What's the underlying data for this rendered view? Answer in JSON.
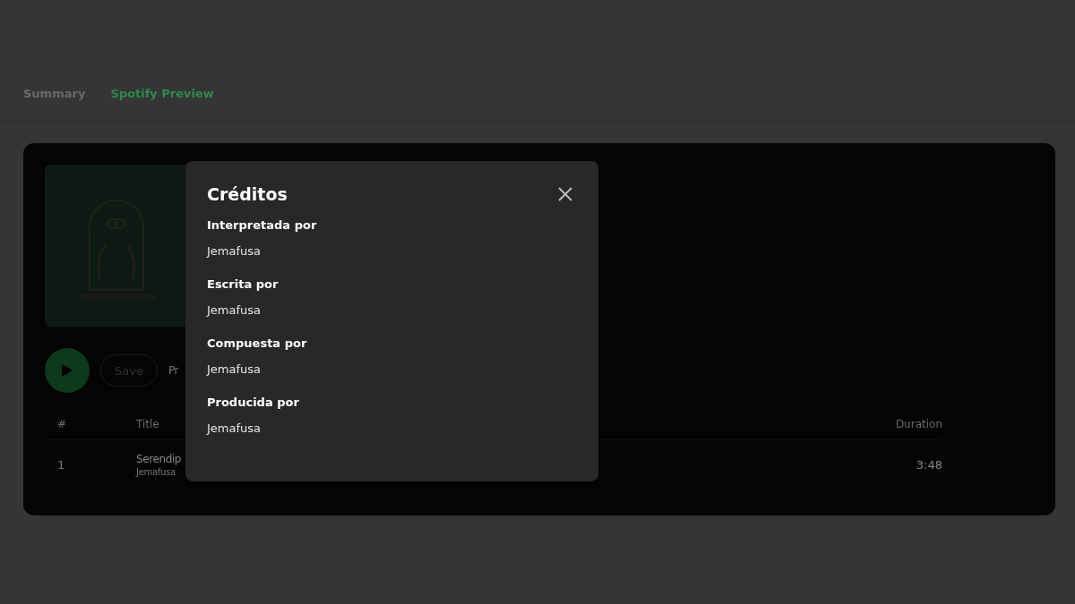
{
  "tabs": [
    {
      "label": "Summary",
      "selected": false
    },
    {
      "label": "Spotify Preview",
      "selected": true
    }
  ],
  "player": {
    "save_label": "Save",
    "cut_label": "Pr"
  },
  "table": {
    "columns": [
      "#",
      "Title",
      "Duration"
    ],
    "rows": [
      {
        "number": "1",
        "title": "Serendip",
        "artist": "Jemafusa",
        "duration": "3:48"
      }
    ]
  },
  "dialog": {
    "title": "Créditos",
    "sections": [
      {
        "heading": "Interpretada por",
        "value": "Jemafusa"
      },
      {
        "heading": "Escrita por",
        "value": "Jemafusa"
      },
      {
        "heading": "Compuesta por",
        "value": "Jemafusa"
      },
      {
        "heading": "Producida por",
        "value": "Jemafusa"
      }
    ]
  }
}
